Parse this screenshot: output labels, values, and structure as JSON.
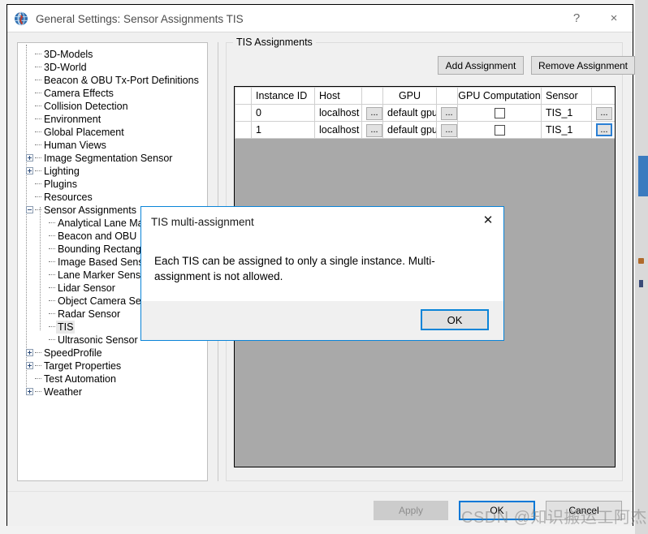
{
  "window": {
    "title": "General Settings: Sensor Assignments TIS",
    "icon": "globe-icon",
    "help_label": "?",
    "close_label": "×"
  },
  "tree": {
    "items": [
      {
        "label": "3D-Models",
        "depth": 1,
        "toggle": "none"
      },
      {
        "label": "3D-World",
        "depth": 1,
        "toggle": "none"
      },
      {
        "label": "Beacon & OBU Tx-Port Definitions",
        "depth": 1,
        "toggle": "none"
      },
      {
        "label": "Camera Effects",
        "depth": 1,
        "toggle": "none"
      },
      {
        "label": "Collision Detection",
        "depth": 1,
        "toggle": "none"
      },
      {
        "label": "Environment",
        "depth": 1,
        "toggle": "none"
      },
      {
        "label": "Global Placement",
        "depth": 1,
        "toggle": "none"
      },
      {
        "label": "Human Views",
        "depth": 1,
        "toggle": "none"
      },
      {
        "label": "Image Segmentation Sensor",
        "depth": 1,
        "toggle": "plus"
      },
      {
        "label": "Lighting",
        "depth": 1,
        "toggle": "plus"
      },
      {
        "label": "Plugins",
        "depth": 1,
        "toggle": "none"
      },
      {
        "label": "Resources",
        "depth": 1,
        "toggle": "none"
      },
      {
        "label": "Sensor Assignments",
        "depth": 1,
        "toggle": "minus"
      },
      {
        "label": "Analytical Lane Marker Sensor",
        "depth": 2,
        "toggle": "none"
      },
      {
        "label": "Beacon and OBU",
        "depth": 2,
        "toggle": "none"
      },
      {
        "label": "Bounding Rectangle Sensor",
        "depth": 2,
        "toggle": "none"
      },
      {
        "label": "Image Based Sensor",
        "depth": 2,
        "toggle": "none"
      },
      {
        "label": "Lane Marker Sensor",
        "depth": 2,
        "toggle": "none"
      },
      {
        "label": "Lidar Sensor",
        "depth": 2,
        "toggle": "none"
      },
      {
        "label": "Object Camera Sensor",
        "depth": 2,
        "toggle": "none"
      },
      {
        "label": "Radar Sensor",
        "depth": 2,
        "toggle": "none"
      },
      {
        "label": "TIS",
        "depth": 2,
        "toggle": "none",
        "selected": true
      },
      {
        "label": "Ultrasonic Sensor",
        "depth": 2,
        "toggle": "none"
      },
      {
        "label": "SpeedProfile",
        "depth": 1,
        "toggle": "plus"
      },
      {
        "label": "Target Properties",
        "depth": 1,
        "toggle": "plus"
      },
      {
        "label": "Test Automation",
        "depth": 1,
        "toggle": "none"
      },
      {
        "label": "Weather",
        "depth": 1,
        "toggle": "plus"
      }
    ]
  },
  "group": {
    "title": "TIS Assignments",
    "add_label": "Add Assignment",
    "remove_label": "Remove Assignment"
  },
  "table": {
    "columns": [
      "",
      "Instance ID",
      "Host",
      "",
      "GPU",
      "",
      "GPU Computation",
      "Sensor",
      ""
    ],
    "ellipsis_label": "...",
    "rows": [
      {
        "instance_id": "0",
        "host": "localhost",
        "host_browse": "...",
        "gpu": "default gpu",
        "gpu_browse": "...",
        "gpu_computation": false,
        "sensor": "TIS_1",
        "sensor_browse": "...",
        "sensor_browse_focused": false
      },
      {
        "instance_id": "1",
        "host": "localhost",
        "host_browse": "...",
        "gpu": "default gpu",
        "gpu_browse": "...",
        "gpu_computation": false,
        "sensor": "TIS_1",
        "sensor_browse": "...",
        "sensor_browse_focused": true
      }
    ]
  },
  "footer": {
    "apply_label": "Apply",
    "ok_label": "OK",
    "cancel_label": "Cancel"
  },
  "dialog": {
    "title": "TIS multi-assignment",
    "close_label": "✕",
    "message": "Each TIS can be assigned to only a single instance. Multi-assignment is not allowed.",
    "ok_label": "OK"
  },
  "watermark": {
    "text": "CSDN @知识搬运工阿杰"
  },
  "colors": {
    "accent_blue": "#0078d7",
    "dialog_border": "#0a84d8",
    "window_bg": "#f0f0f0",
    "grid_empty_bg": "#a9a9a9",
    "selection_bg": "#e8e8e8"
  }
}
